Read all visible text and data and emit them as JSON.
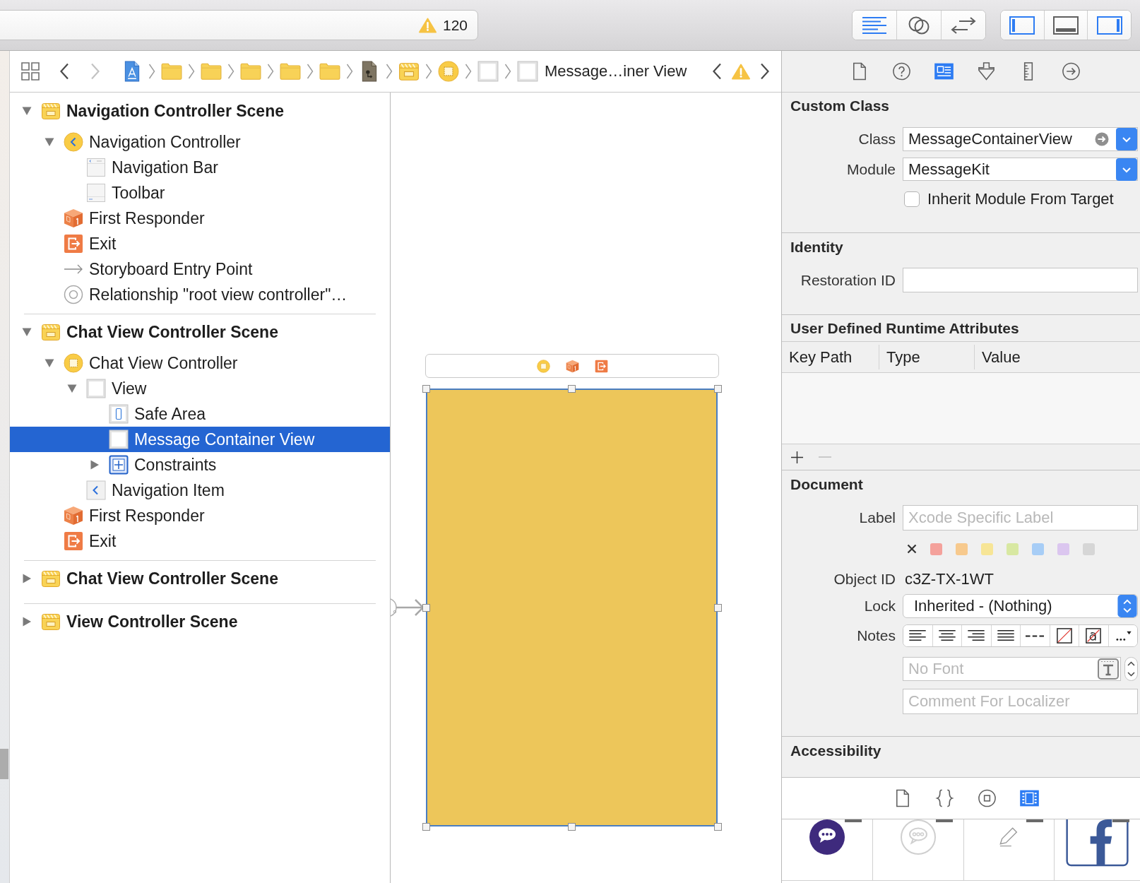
{
  "toolbar": {
    "activity": {
      "warning_count": "120"
    },
    "editor_modes": [
      {
        "kind": "standard",
        "selected": true
      },
      {
        "kind": "assistant",
        "selected": false
      },
      {
        "kind": "version",
        "selected": false
      }
    ],
    "panels": [
      {
        "kind": "navigator",
        "on": true
      },
      {
        "kind": "debug",
        "on": false
      },
      {
        "kind": "utilities",
        "on": true
      }
    ]
  },
  "jump_bar": {
    "history": [
      {
        "kind": "back",
        "disabled": false
      },
      {
        "kind": "forward",
        "disabled": true
      }
    ],
    "path": [
      {
        "kind": "storyboard"
      },
      {
        "kind": "folder"
      },
      {
        "kind": "folder"
      },
      {
        "kind": "folder"
      },
      {
        "kind": "folder"
      },
      {
        "kind": "folder"
      },
      {
        "kind": "file"
      },
      {
        "kind": "scene"
      },
      {
        "kind": "view-controller"
      },
      {
        "kind": "view"
      },
      {
        "kind": "view",
        "label": "Message…iner View"
      }
    ]
  },
  "outline": {
    "scenes": [
      {
        "kind": "scene",
        "label": "Navigation Controller Scene",
        "expanded": true,
        "selected": false,
        "children": [
          {
            "kind": "navigation-controller",
            "label": "Navigation Controller",
            "expanded": true,
            "selected": false,
            "children": [
              {
                "kind": "navigation-bar",
                "label": "Navigation Bar",
                "selected": false
              },
              {
                "kind": "toolbar",
                "label": "Toolbar",
                "selected": false
              }
            ]
          },
          {
            "kind": "first-responder",
            "label": "First Responder",
            "selected": false
          },
          {
            "kind": "exit",
            "label": "Exit",
            "selected": false
          },
          {
            "kind": "entry-point",
            "label": "Storyboard Entry Point",
            "selected": false
          },
          {
            "kind": "relationship",
            "label": "Relationship \"root view controller\"…",
            "selected": false
          }
        ]
      },
      {
        "kind": "scene",
        "label": "Chat View Controller Scene",
        "expanded": true,
        "selected": false,
        "children": [
          {
            "kind": "view-controller",
            "label": "Chat View Controller",
            "expanded": true,
            "selected": false,
            "children": [
              {
                "kind": "view",
                "label": "View",
                "expanded": true,
                "selected": false,
                "children": [
                  {
                    "kind": "safe-area",
                    "label": "Safe Area",
                    "selected": false
                  },
                  {
                    "kind": "view",
                    "label": "Message Container View",
                    "selected": true
                  },
                  {
                    "kind": "constraints",
                    "label": "Constraints",
                    "expanded": false,
                    "selected": false
                  }
                ]
              },
              {
                "kind": "navigation-item",
                "label": "Navigation Item",
                "selected": false
              }
            ]
          },
          {
            "kind": "first-responder",
            "label": "First Responder",
            "selected": false
          },
          {
            "kind": "exit",
            "label": "Exit",
            "selected": false
          }
        ]
      },
      {
        "kind": "scene",
        "label": "Chat View Controller Scene",
        "expanded": false,
        "selected": false
      },
      {
        "kind": "scene",
        "label": "View Controller Scene",
        "expanded": false,
        "selected": false
      }
    ]
  },
  "canvas": {
    "scene_dock": [
      {
        "kind": "view-controller"
      },
      {
        "kind": "first-responder"
      },
      {
        "kind": "exit"
      }
    ],
    "view": {
      "selected": true
    }
  },
  "inspector": {
    "tabs": [
      {
        "kind": "file",
        "selected": false
      },
      {
        "kind": "help",
        "selected": false
      },
      {
        "kind": "identity",
        "selected": true
      },
      {
        "kind": "attributes",
        "selected": false
      },
      {
        "kind": "size",
        "selected": false
      },
      {
        "kind": "connections",
        "selected": false
      }
    ],
    "custom_class": {
      "title": "Custom Class",
      "class": {
        "label": "Class",
        "value": "MessageContainerView"
      },
      "module": {
        "label": "Module",
        "value": "MessageKit"
      },
      "inherit": {
        "label": "Inherit Module From Target",
        "checked": false
      }
    },
    "identity": {
      "title": "Identity",
      "restoration_id": {
        "label": "Restoration ID"
      }
    },
    "runtime_attributes": {
      "title": "User Defined Runtime Attributes",
      "columns": [
        "Key Path",
        "Type",
        "Value"
      ],
      "buttons": [
        {
          "kind": "add",
          "disabled": false
        },
        {
          "kind": "remove",
          "disabled": true
        }
      ]
    },
    "document": {
      "title": "Document",
      "label": {
        "label": "Label",
        "placeholder": "Xcode Specific Label"
      },
      "label_colors": [
        {
          "color": "#f4a19b",
          "selected": false
        },
        {
          "color": "#f7c98d",
          "selected": false
        },
        {
          "color": "#f7e596",
          "selected": false
        },
        {
          "color": "#d8e8a2",
          "selected": false
        },
        {
          "color": "#a7cdf6",
          "selected": false
        },
        {
          "color": "#dbc6ef",
          "selected": false
        },
        {
          "color": "#d6d6d6",
          "selected": false
        }
      ],
      "object_id": {
        "label": "Object ID",
        "value": "c3Z-TX-1WT"
      },
      "lock": {
        "label": "Lock",
        "value": "Inherited - (Nothing)"
      },
      "notes": {
        "label": "Notes",
        "tools": [
          {
            "kind": "align-left"
          },
          {
            "kind": "align-center"
          },
          {
            "kind": "align-right"
          },
          {
            "kind": "justify"
          },
          {
            "kind": "natural"
          },
          {
            "kind": "background-color"
          },
          {
            "kind": "text-color"
          },
          {
            "kind": "more"
          }
        ],
        "font_placeholder": "No Font",
        "comment_placeholder": "Comment For Localizer"
      }
    },
    "accessibility": {
      "title": "Accessibility"
    }
  },
  "library": {
    "tabs": [
      {
        "kind": "file",
        "selected": false
      },
      {
        "kind": "code",
        "selected": false
      },
      {
        "kind": "object",
        "selected": false
      },
      {
        "kind": "media",
        "selected": true
      }
    ],
    "items": [
      {
        "kind": "chat-filled"
      },
      {
        "kind": "chat-outline"
      },
      {
        "kind": "pencil"
      },
      {
        "kind": "facebook"
      }
    ]
  }
}
